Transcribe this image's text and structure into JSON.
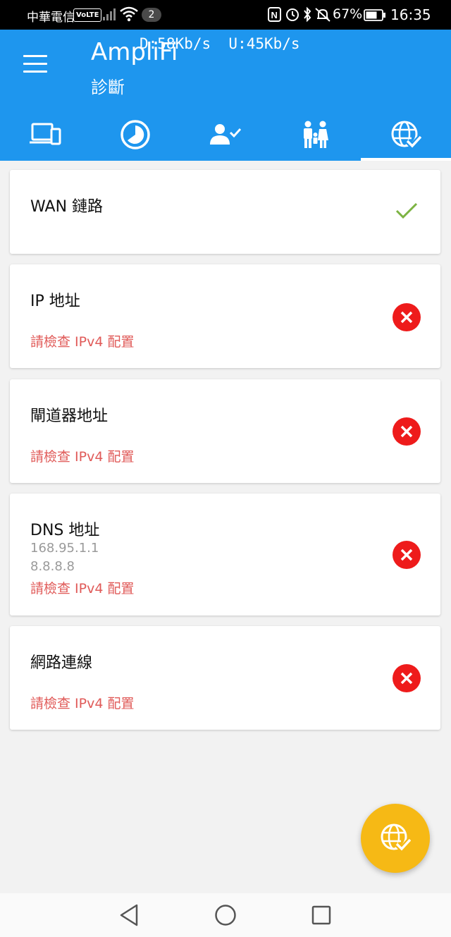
{
  "status_bar": {
    "carrier": "中華電信",
    "volte": "VoLTE",
    "notification_count": "2",
    "battery": "67%",
    "time": "16:35"
  },
  "app_bar": {
    "title": "AmpliFi",
    "subtitle": "診斷",
    "speed_overlay": "D:58Kb/s  U:45Kb/s"
  },
  "tabs": [
    {
      "icon": "devices-icon",
      "active": false
    },
    {
      "icon": "speed-clock-icon",
      "active": false
    },
    {
      "icon": "user-check-icon",
      "active": false
    },
    {
      "icon": "family-icon",
      "active": false
    },
    {
      "icon": "globe-check-icon",
      "active": true
    }
  ],
  "cards": [
    {
      "title": "WAN 鏈路",
      "status": "ok"
    },
    {
      "title": "IP 地址",
      "message": "請檢查 IPv4 配置",
      "status": "error"
    },
    {
      "title": "閘道器地址",
      "message": "請檢查 IPv4 配置",
      "status": "error"
    },
    {
      "title": "DNS 地址",
      "info": [
        "168.95.1.1",
        "8.8.8.8"
      ],
      "message": "請檢查 IPv4 配置",
      "status": "error"
    },
    {
      "title": "網路連線",
      "message": "請檢查 IPv4 配置",
      "status": "error"
    }
  ],
  "colors": {
    "primary": "#1e96ee",
    "error": "#ee1b1b",
    "ok": "#7cb342",
    "fab": "#f6b915",
    "error_text": "#e05a58"
  },
  "fab": {
    "icon": "globe-check-icon"
  }
}
